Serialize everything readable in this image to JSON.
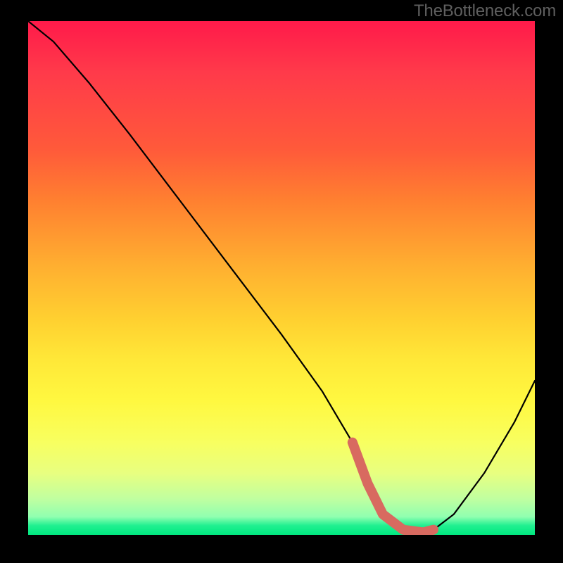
{
  "watermark": "TheBottleneck.com",
  "chart_data": {
    "type": "line",
    "title": "",
    "xlabel": "",
    "ylabel": "",
    "xlim": [
      0,
      100
    ],
    "ylim": [
      0,
      100
    ],
    "series": [
      {
        "name": "bottleneck-curve",
        "x": [
          0,
          5,
          12,
          20,
          30,
          40,
          50,
          58,
          64,
          67,
          70,
          74,
          78,
          80,
          84,
          90,
          96,
          100
        ],
        "values": [
          100,
          96,
          88,
          78,
          65,
          52,
          39,
          28,
          18,
          10,
          4,
          1,
          0.5,
          1,
          4,
          12,
          22,
          30
        ]
      }
    ],
    "highlight": {
      "name": "optimal-range",
      "x": [
        64,
        67,
        70,
        74,
        78,
        80
      ],
      "values": [
        18,
        10,
        4,
        1,
        0.5,
        1
      ],
      "color": "#d86a60"
    },
    "gradient_stops": [
      {
        "pos": 0,
        "color": "#ff1a4a"
      },
      {
        "pos": 0.5,
        "color": "#ffd030"
      },
      {
        "pos": 0.85,
        "color": "#f8ff60"
      },
      {
        "pos": 1.0,
        "color": "#00e880"
      }
    ]
  }
}
